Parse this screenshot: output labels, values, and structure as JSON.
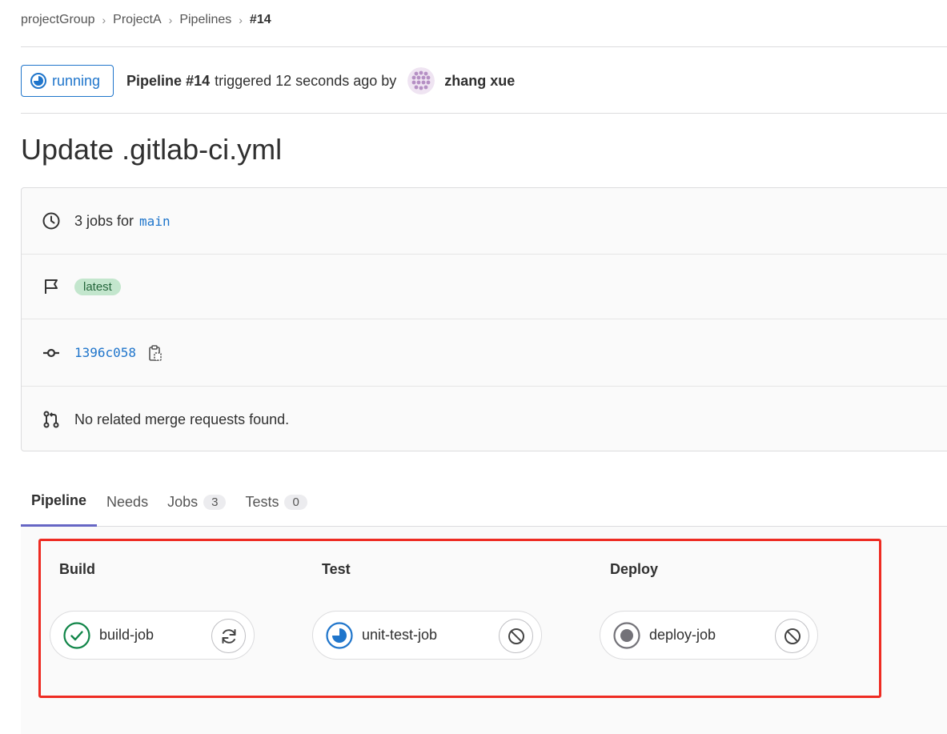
{
  "breadcrumb": {
    "items": [
      {
        "label": "projectGroup"
      },
      {
        "label": "ProjectA"
      },
      {
        "label": "Pipelines"
      },
      {
        "label": "#14"
      }
    ]
  },
  "header": {
    "status": "running",
    "pipeline_label": "Pipeline #14",
    "triggered_text": "triggered 12 seconds ago by",
    "author": "zhang xue"
  },
  "title": "Update .gitlab-ci.yml",
  "info": {
    "jobs_prefix": "3 jobs for",
    "branch": "main",
    "badge": "latest",
    "commit_sha": "1396c058",
    "merge_requests": "No related merge requests found."
  },
  "tabs": [
    {
      "label": "Pipeline",
      "count": null
    },
    {
      "label": "Needs",
      "count": null
    },
    {
      "label": "Jobs",
      "count": "3"
    },
    {
      "label": "Tests",
      "count": "0"
    }
  ],
  "stages": [
    {
      "name": "Build",
      "job": {
        "name": "build-job",
        "status": "success",
        "action_icon": "retry-icon"
      }
    },
    {
      "name": "Test",
      "job": {
        "name": "unit-test-job",
        "status": "running",
        "action_icon": "cancel-icon"
      }
    },
    {
      "name": "Deploy",
      "job": {
        "name": "deploy-job",
        "status": "created",
        "action_icon": "cancel-icon"
      }
    }
  ],
  "colors": {
    "link": "#1f75cb",
    "success": "#108548",
    "running": "#1f75cb",
    "created": "#737278",
    "highlight": "#ee2b22",
    "active_tab": "#6666c4"
  }
}
